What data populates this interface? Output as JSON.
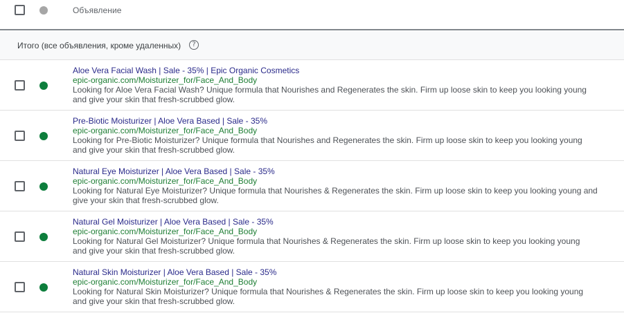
{
  "header": {
    "column_title": "Объявление"
  },
  "summary": {
    "label": "Итого (все объявления, кроме удаленных)",
    "help_glyph": "?"
  },
  "colors": {
    "status_enabled": "#0d7e3c",
    "status_header": "#a6a6a6",
    "headline": "#2a2a8a",
    "url": "#1e7e34"
  },
  "ads": [
    {
      "headline": "Aloe Vera Facial Wash | Sale - 35% | Epic Organic Cosmetics",
      "url": "epic-organic.com/Moisturizer_for/Face_And_Body",
      "description_line1": "Looking for Aloe Vera Facial Wash? Unique formula that Nourishes and Regenerates the skin. Firm up loose skin to keep you looking young",
      "description_line2": "and give your skin that fresh-scrubbed glow."
    },
    {
      "headline": "Pre-Biotic Moisturizer | Aloe Vera Based | Sale - 35%",
      "url": "epic-organic.com/Moisturizer_for/Face_And_Body",
      "description_line1": "Looking for Pre-Biotic Moisturizer? Unique formula that Nourishes and Regenerates the skin. Firm up loose skin to keep you looking young",
      "description_line2": "and give your skin that fresh-scrubbed glow."
    },
    {
      "headline": "Natural Eye Moisturizer | Aloe Vera Based | Sale - 35%",
      "url": "epic-organic.com/Moisturizer_for/Face_And_Body",
      "description_line1": "Looking for Natural Eye Moisturizer? Unique formula that Nourishes & Regenerates the skin. Firm up loose skin to keep you looking young and",
      "description_line2": "give your skin that fresh-scrubbed glow."
    },
    {
      "headline": "Natural Gel Moisturizer | Aloe Vera Based | Sale - 35%",
      "url": "epic-organic.com/Moisturizer_for/Face_And_Body",
      "description_line1": "Looking for Natural Gel Moisturizer? Unique formula that Nourishes & Regenerates the skin. Firm up loose skin to keep you looking young",
      "description_line2": "and give your skin that fresh-scrubbed glow."
    },
    {
      "headline": "Natural Skin Moisturizer | Aloe Vera Based | Sale - 35%",
      "url": "epic-organic.com/Moisturizer_for/Face_And_Body",
      "description_line1": "Looking for Natural Skin Moisturizer? Unique formula that Nourishes & Regenerates the skin. Firm up loose skin to keep you looking young",
      "description_line2": "and give your skin that fresh-scrubbed glow."
    }
  ]
}
